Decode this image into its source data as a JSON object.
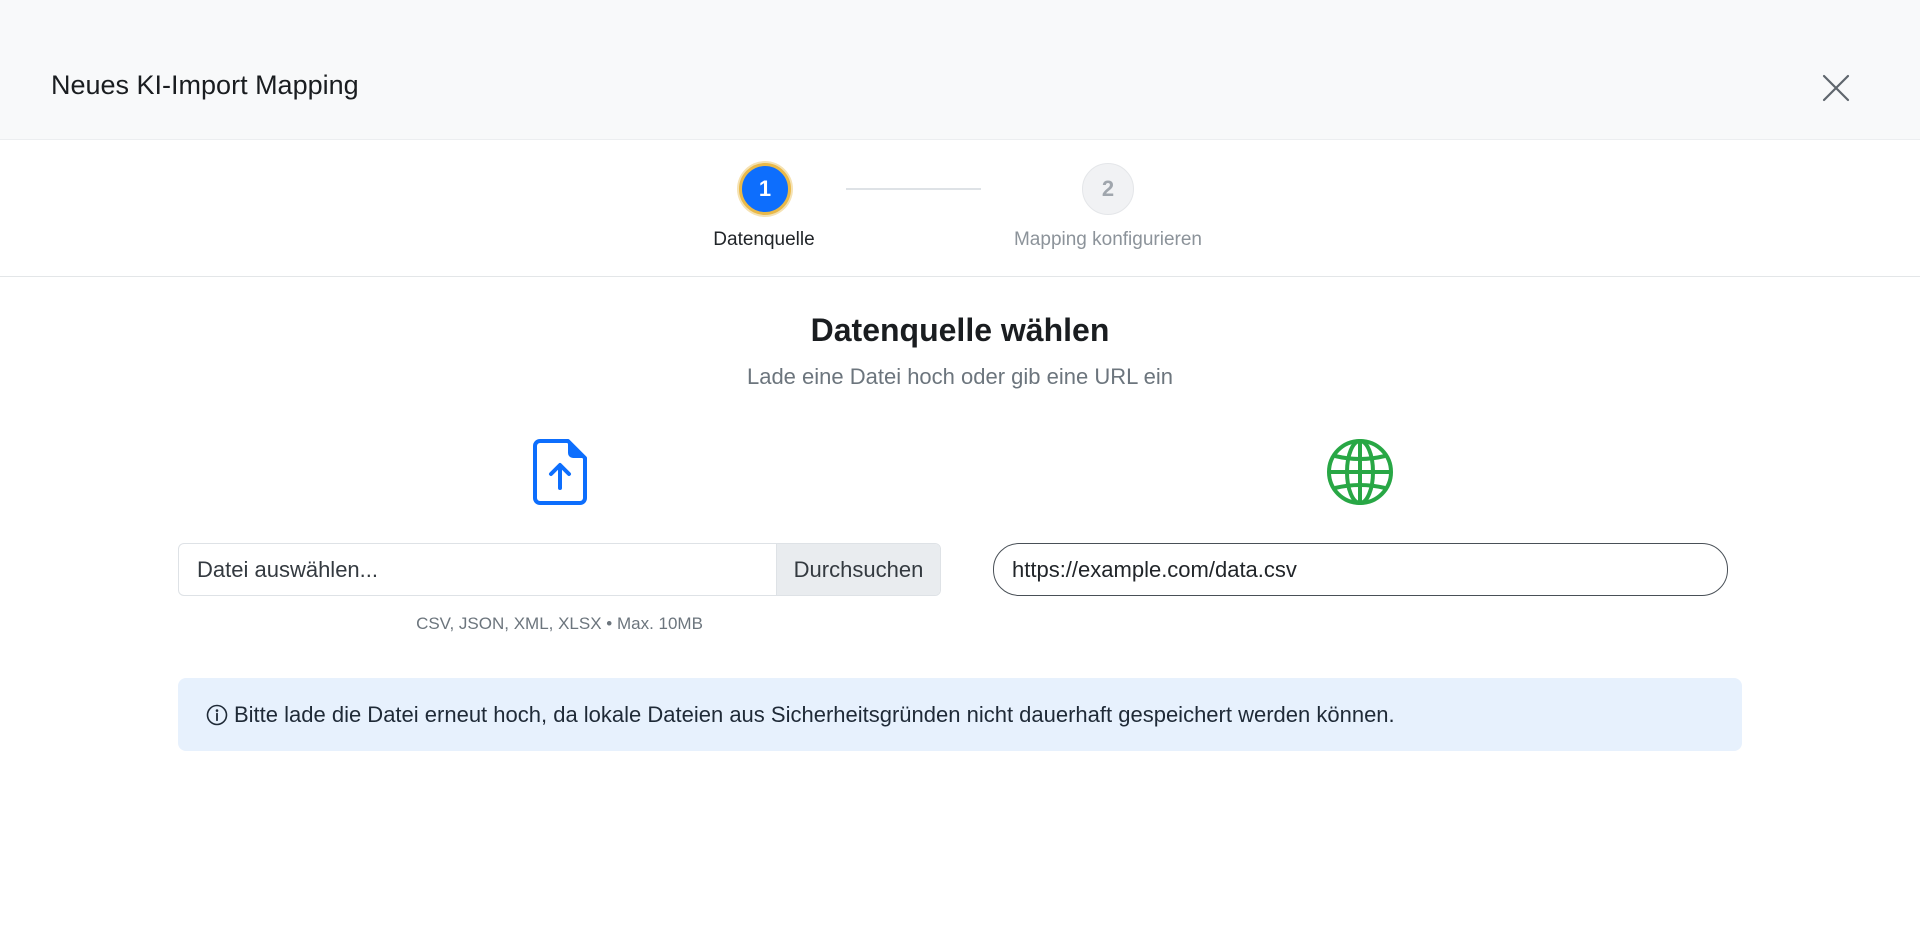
{
  "modal": {
    "title": "Neues KI-Import Mapping",
    "close_icon": "close-icon"
  },
  "stepper": {
    "steps": [
      {
        "number": "1",
        "label": "Datenquelle",
        "state": "active"
      },
      {
        "number": "2",
        "label": "Mapping konfigurieren",
        "state": "inactive"
      }
    ]
  },
  "main": {
    "title": "Datenquelle wählen",
    "subtitle": "Lade eine Datei hoch oder gib eine URL ein"
  },
  "file_upload": {
    "icon": "file-upload-icon",
    "placeholder": "Datei auswählen...",
    "browse_label": "Durchsuchen",
    "hint": "CSV, JSON, XML, XLSX • Max. 10MB"
  },
  "url_input": {
    "icon": "globe-icon",
    "value": "https://example.com/data.csv"
  },
  "alert": {
    "icon": "info-circle-icon",
    "text": "Bitte lade die Datei erneut hoch, da lokale Dateien aus Sicherheitsgründen nicht dauerhaft gespeichert werden können."
  },
  "colors": {
    "primary": "#0d6efd",
    "success": "#28a745",
    "active_ring": "#e9b949",
    "alert_bg": "#e7f1fd"
  }
}
